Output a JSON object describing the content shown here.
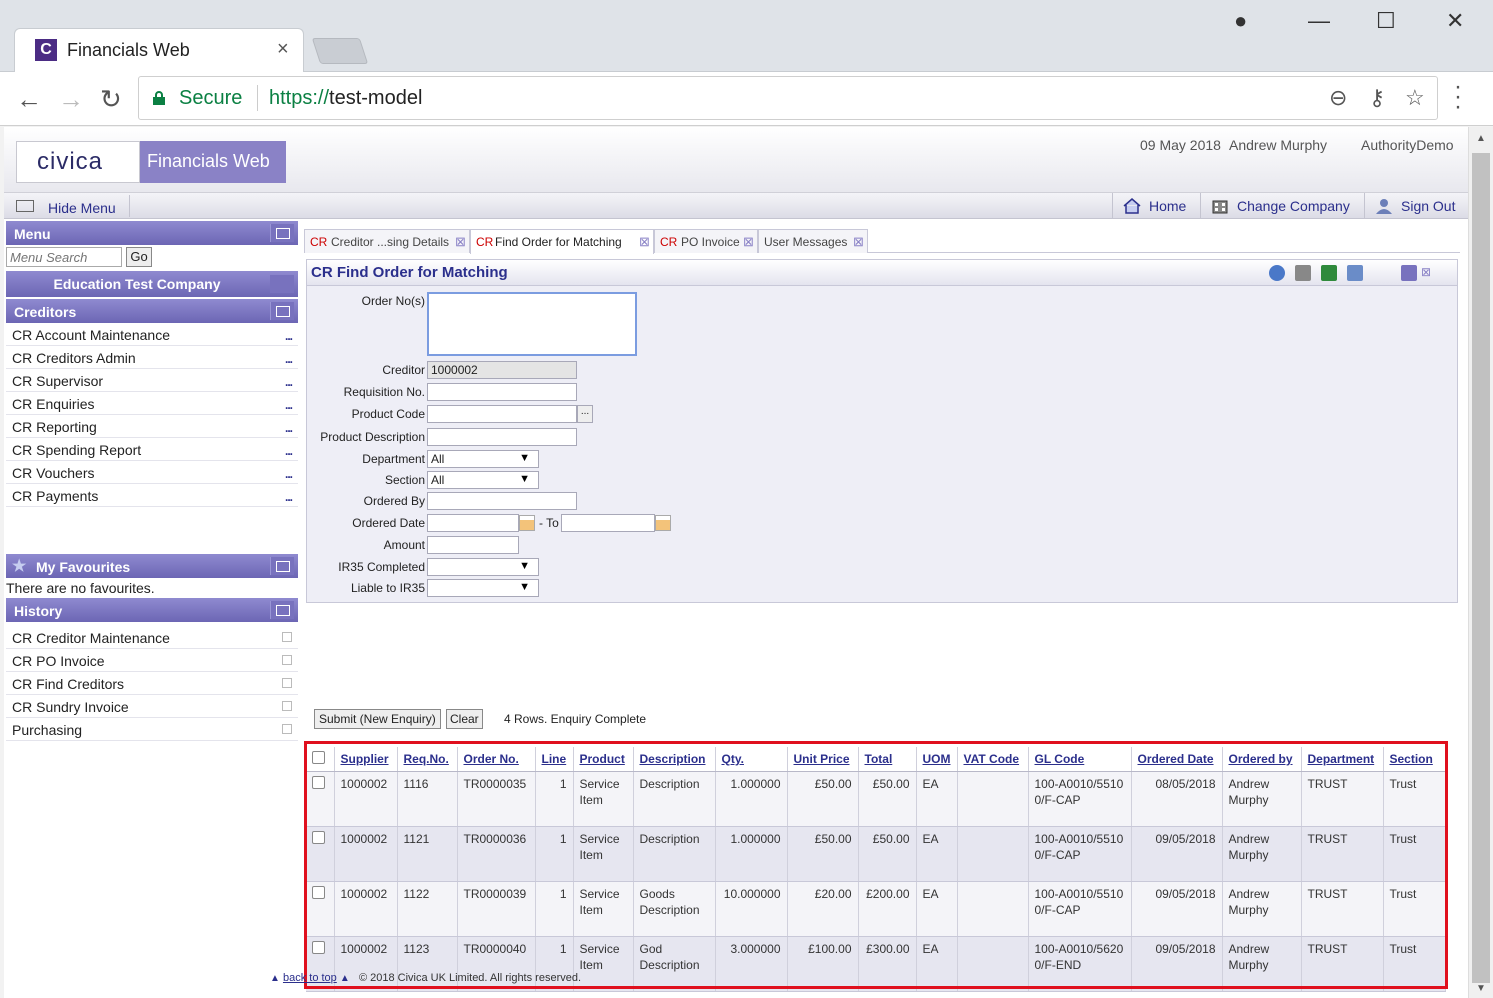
{
  "browser": {
    "tab_title": "Financials Web",
    "favicon_letter": "C",
    "secure_label": "Secure",
    "url_scheme": "https://",
    "url_host": "test-model"
  },
  "header": {
    "logo": "civica",
    "app_name": "Financials Web",
    "date": "09 May 2018",
    "user": "Andrew Murphy",
    "authority": "AuthorityDemo"
  },
  "navbar": {
    "hide_menu": "Hide Menu",
    "home": "Home",
    "change_company": "Change Company",
    "sign_out": "Sign Out"
  },
  "sidebar": {
    "menu_title": "Menu",
    "search_placeholder": "Menu Search",
    "go_label": "Go",
    "company": "Education Test Company",
    "section_title": "Creditors",
    "items": [
      {
        "label": "CR Account Maintenance"
      },
      {
        "label": "CR Creditors Admin"
      },
      {
        "label": "CR Supervisor"
      },
      {
        "label": "CR Enquiries"
      },
      {
        "label": "CR Reporting"
      },
      {
        "label": "CR Spending Report"
      },
      {
        "label": "CR Vouchers"
      },
      {
        "label": "CR Payments"
      }
    ],
    "favourites_title": "My Favourites",
    "no_favourites": "There are no favourites.",
    "history_title": "History",
    "history": [
      {
        "label": "CR Creditor Maintenance"
      },
      {
        "label": "CR PO Invoice"
      },
      {
        "label": "CR Find Creditors"
      },
      {
        "label": "CR Sundry Invoice"
      },
      {
        "label": "Purchasing"
      }
    ]
  },
  "page_tabs": [
    {
      "prefix": "CR",
      "label": "Creditor ...sing Details"
    },
    {
      "prefix": "CR",
      "label": "Find Order for Matching"
    },
    {
      "prefix": "CR",
      "label": "PO Invoice"
    },
    {
      "prefix": "",
      "label": "User Messages"
    }
  ],
  "form": {
    "title": "CR Find Order for Matching",
    "labels": {
      "order_nos": "Order No(s)",
      "creditor": "Creditor",
      "requisition": "Requisition No.",
      "product_code": "Product Code",
      "product_description": "Product Description",
      "department": "Department",
      "section": "Section",
      "ordered_by": "Ordered By",
      "ordered_date": "Ordered Date",
      "to": "- To",
      "amount": "Amount",
      "ir35_completed": "IR35 Completed",
      "liable_ir35": "Liable to IR35"
    },
    "values": {
      "creditor": "1000002",
      "department": "All",
      "section": "All",
      "product_code_browse": "..."
    },
    "submit_label": "Submit (New Enquiry)",
    "clear_label": "Clear",
    "status": "4 Rows. Enquiry Complete"
  },
  "grid": {
    "columns": [
      "Supplier",
      "Req.No.",
      "Order No.",
      "Line",
      "Product",
      "Description",
      "Qty.",
      "Unit Price",
      "Total",
      "UOM",
      "VAT Code",
      "GL Code",
      "Ordered Date",
      "Ordered by",
      "Department",
      "Section"
    ],
    "rows": [
      [
        "1000002",
        "1116",
        "TR0000035",
        "1",
        "Service Item",
        "Description",
        "1.000000",
        "£50.00",
        "£50.00",
        "EA",
        "",
        "100-A0010/55100/F-CAP",
        "08/05/2018",
        "Andrew Murphy",
        "TRUST",
        "Trust"
      ],
      [
        "1000002",
        "1121",
        "TR0000036",
        "1",
        "Service Item",
        "Description",
        "1.000000",
        "£50.00",
        "£50.00",
        "EA",
        "",
        "100-A0010/55100/F-CAP",
        "09/05/2018",
        "Andrew Murphy",
        "TRUST",
        "Trust"
      ],
      [
        "1000002",
        "1122",
        "TR0000039",
        "1",
        "Service Item",
        "Goods Description",
        "10.000000",
        "£20.00",
        "£200.00",
        "EA",
        "",
        "100-A0010/55100/F-CAP",
        "09/05/2018",
        "Andrew Murphy",
        "TRUST",
        "Trust"
      ],
      [
        "1000002",
        "1123",
        "TR0000040",
        "1",
        "Service Item",
        "God Description",
        "3.000000",
        "£100.00",
        "£300.00",
        "EA",
        "",
        "100-A0010/56200/F-END",
        "09/05/2018",
        "Andrew Murphy",
        "TRUST",
        "Trust"
      ]
    ]
  },
  "footer": {
    "back_to_top": "back to top",
    "copyright": "© 2018 Civica UK Limited. All rights reserved."
  },
  "colors": {
    "accent": "#6c66b4",
    "highlight": "#e0101e",
    "link": "#2b2f8c"
  }
}
